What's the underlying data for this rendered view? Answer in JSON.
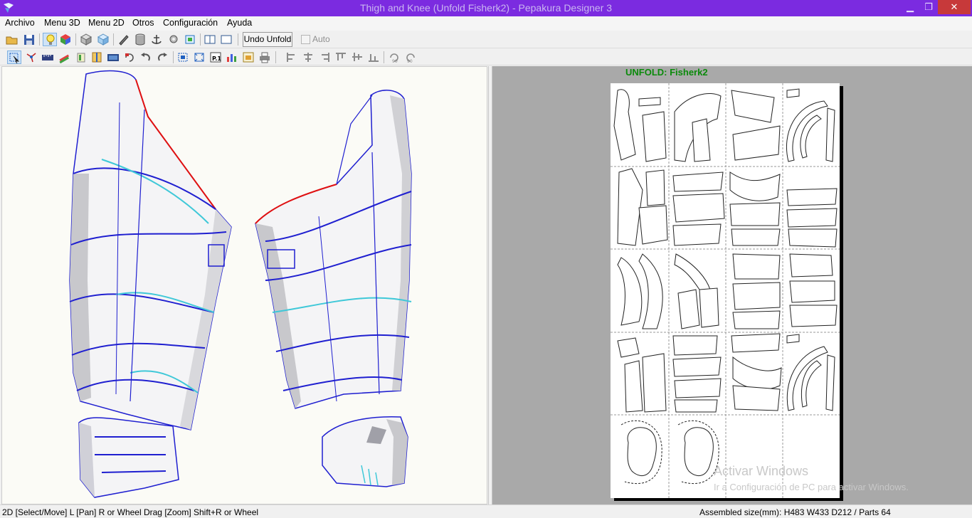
{
  "window": {
    "title": "Thigh and Knee (Unfold Fisherk2) - Pepakura Designer 3",
    "controls": {
      "minimize": "▁",
      "maximize": "❐",
      "close": "✕"
    }
  },
  "menu": [
    "Archivo",
    "Menu 3D",
    "Menu 2D",
    "Otros",
    "Configuración",
    "Ayuda"
  ],
  "toolbar1": {
    "undo_unfold_label": "Undo Unfold",
    "auto_label": "Auto",
    "auto_checked": false,
    "icons": [
      "open-icon",
      "save-icon",
      "lightbulb-icon",
      "color-cube-icon",
      "wireframe-cube-icon",
      "texture-cube-icon",
      "pencil-icon",
      "cylinder-icon",
      "anchor-icon",
      "settings-icon",
      "flap-icon",
      "single-view-icon",
      "dual-view-icon"
    ]
  },
  "toolbar2": {
    "icons": [
      "select-icon",
      "join-edge-icon",
      "ruler-icon",
      "paint-icon",
      "cut-icon",
      "fold-icon",
      "move-part-icon",
      "rotate-icon",
      "undo-icon",
      "redo-icon",
      "arrange-icon",
      "snap-icon",
      "page-number-icon",
      "statistics-icon",
      "page-icon",
      "print-icon",
      "align-left-icon",
      "align-center-icon",
      "align-right-icon",
      "align-top-icon",
      "align-middle-icon",
      "align-bottom-icon",
      "rotate-90-ccw-icon",
      "rotate-90-cw-icon"
    ]
  },
  "view2d": {
    "heading": "UNFOLD: Fisherk2"
  },
  "watermark": {
    "line1": "Activar Windows",
    "line2": "Ir a Configuración de PC para activar Windows."
  },
  "status": {
    "left": "2D [Select/Move] L [Pan] R or Wheel Drag [Zoom] Shift+R or Wheel",
    "right": "Assembled size(mm): H483 W433 D212 / Parts 64"
  },
  "colors": {
    "titlebar": "#7b2be0",
    "unfold_heading": "#0a8a0a",
    "edge_blue": "#1f1fd0",
    "edge_cyan": "#3fc8d8",
    "edge_red": "#e01010"
  }
}
